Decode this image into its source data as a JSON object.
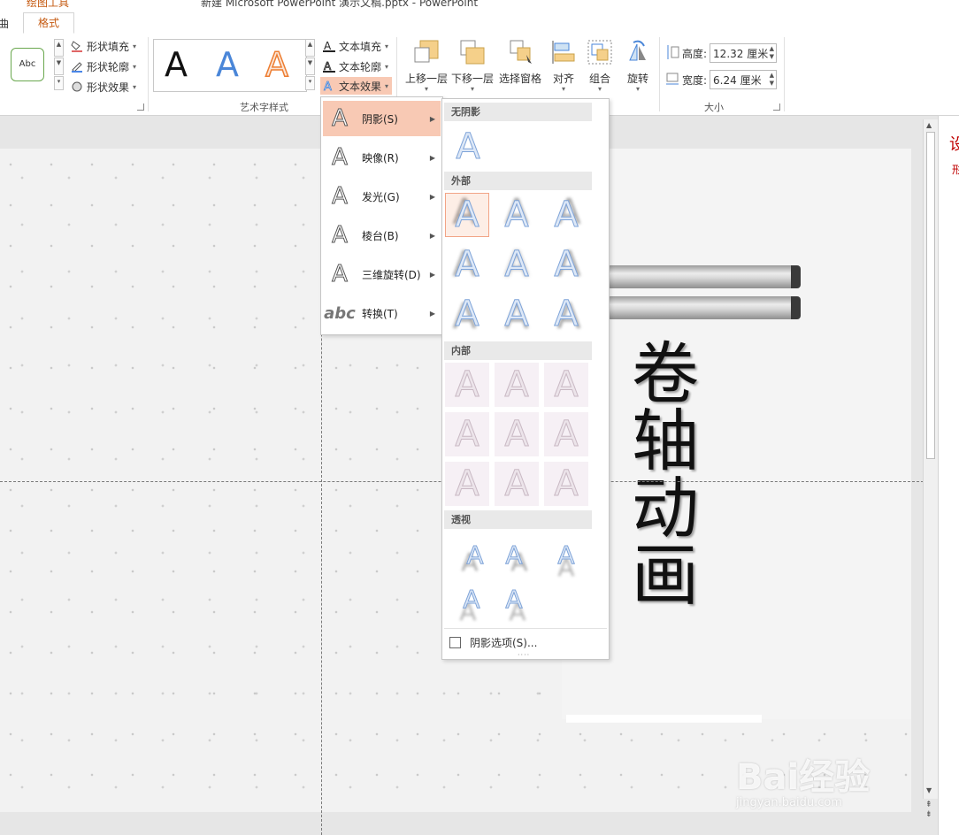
{
  "window": {
    "context_tab_group": "绘图工具",
    "document_title": "新建 Microsoft PowerPoint 演示文稿.pptx - PowerPoint"
  },
  "tabs": {
    "left_partial": "曲",
    "format": "格式"
  },
  "ribbon": {
    "shape_style_sample": "Abc",
    "shape_fill": "形状填充",
    "shape_outline": "形状轮廓",
    "shape_effects": "形状效果",
    "wordart_samples": [
      "A",
      "A",
      "A"
    ],
    "text_fill": "文本填充",
    "text_outline": "文本轮廓",
    "text_effects": "文本效果",
    "wordart_group_label": "艺术字样式",
    "bring_forward": "上移一层",
    "send_backward": "下移一层",
    "selection_pane": "选择窗格",
    "align": "对齐",
    "group": "组合",
    "rotate": "旋转",
    "height_label": "高度:",
    "height_value": "12.32 厘米",
    "width_label": "宽度:",
    "width_value": "6.24 厘米",
    "size_group_label": "大小"
  },
  "text_effects_menu": {
    "items": [
      {
        "label": "阴影(S)",
        "icon": "shadow-A-icon",
        "active": true
      },
      {
        "label": "映像(R)",
        "icon": "reflection-A-icon"
      },
      {
        "label": "发光(G)",
        "icon": "glow-A-icon"
      },
      {
        "label": "棱台(B)",
        "icon": "bevel-A-icon"
      },
      {
        "label": "三维旋转(D)",
        "icon": "3d-rotation-A-icon"
      },
      {
        "label": "转换(T)",
        "icon": "transform-abc-icon",
        "glyph": "abc"
      }
    ]
  },
  "shadow_gallery": {
    "sections": {
      "none": "无阴影",
      "outer": "外部",
      "inner": "内部",
      "perspective": "透视"
    },
    "glyph": "A",
    "options_label": "阴影选项(S)..."
  },
  "slide": {
    "title_vertical": "卷轴动画"
  },
  "watermark": {
    "brand": "Bai经验",
    "url": "jingyan.baidu.com"
  },
  "right_pane": {
    "t1": "设",
    "t2": "形"
  }
}
